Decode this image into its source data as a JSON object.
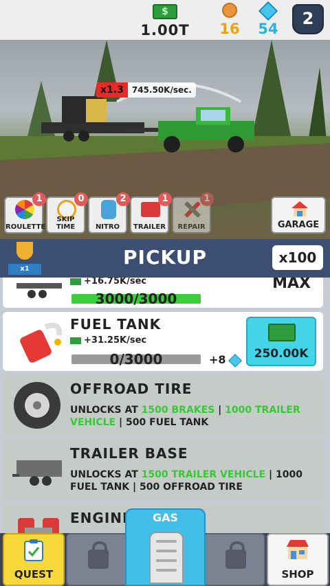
{
  "topbar": {
    "cash": "1.00T",
    "coins": "16",
    "gems": "54",
    "level": "2"
  },
  "scene": {
    "multiplier": "x1.3",
    "income_rate": "745.50K/sec."
  },
  "boosts": [
    {
      "label": "ROULETTE",
      "count": "1",
      "icon": "roulette-wheel-icon"
    },
    {
      "label": "SKIP TIME",
      "count": "0",
      "icon": "stopwatch-icon"
    },
    {
      "label": "NITRO",
      "count": "2",
      "icon": "nitro-tank-icon"
    },
    {
      "label": "TRAILER",
      "count": "1",
      "icon": "trailer-crate-icon"
    },
    {
      "label": "REPAIR",
      "count": "1",
      "icon": "wrench-screwdriver-icon"
    }
  ],
  "garage": {
    "label": "GARAGE"
  },
  "upgrades_header": {
    "title": "PICKUP",
    "trophy_label": "x1",
    "buy_multiplier": "x100"
  },
  "upgrades": [
    {
      "name": "trailer",
      "rate": "+16.75K/sec",
      "progress_text": "3000/3000",
      "progress": 1.0,
      "status": "MAX"
    },
    {
      "name": "FUEL TANK",
      "rate": "+31.25K/sec",
      "progress_text": "0/3000",
      "progress": 0.0,
      "gem_bonus": "+8",
      "price": "250.00K"
    },
    {
      "name": "OFFROAD TIRE",
      "unlock_prefix": "UNLOCKS AT",
      "req1": "1500 BRAKES",
      "req2": "1000 TRAILER VEHICLE",
      "req3": "500 FUEL TANK"
    },
    {
      "name": "TRAILER BASE",
      "unlock_prefix": "UNLOCKS AT",
      "req1": "1500 TRAILER VEHICLE",
      "req2": "1000 FUEL TANK",
      "req3": "500 OFFROAD TIRE"
    },
    {
      "name": "ENGINE"
    }
  ],
  "bottom_nav": {
    "quest": "QUEST",
    "gas": "GAS",
    "shop": "SHOP"
  }
}
